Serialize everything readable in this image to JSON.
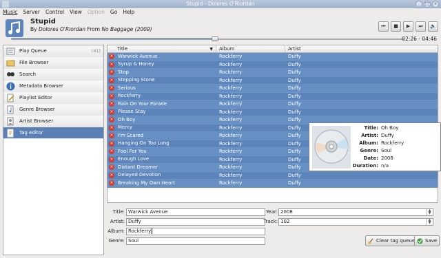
{
  "window": {
    "title": "Stupid - Dolores O'Riordan",
    "buttons": [
      "close-icon",
      "maximize-icon",
      "minimize-icon"
    ]
  },
  "menu": [
    "Music",
    "Server",
    "Control",
    "View",
    "Option",
    "Go",
    "Help"
  ],
  "now_playing": {
    "title": "Stupid",
    "by_prefix": "By",
    "artist": "Dolores O'Riordan",
    "from_prefix": "From",
    "album": "No Baggage",
    "year": "(2009)",
    "time": "02:26 - 04:46",
    "progress": 0.52,
    "controls": [
      "previous-icon",
      "stop-icon",
      "play-icon",
      "next-icon",
      "volume-icon"
    ]
  },
  "sidebar": {
    "items": [
      {
        "label": "Play Queue",
        "count": "(41)",
        "icon": "queue-icon"
      },
      {
        "label": "File Browser",
        "icon": "file-browser-icon"
      },
      {
        "label": "Search",
        "icon": "search-icon"
      },
      {
        "label": "Metadata Browser",
        "icon": "info-icon"
      },
      {
        "label": "Playlist Editor",
        "icon": "playlist-editor-icon"
      },
      {
        "label": "Genre Browser",
        "icon": "genre-icon"
      },
      {
        "label": "Artist Browser",
        "icon": "artist-icon"
      },
      {
        "label": "Tag editor",
        "icon": "tag-icon",
        "active": true
      }
    ]
  },
  "playlist": {
    "columns": [
      "Title",
      "Album",
      "Artist"
    ],
    "rows": [
      {
        "title": "Warwick Avenue",
        "album": "Rockferry",
        "artist": "Duffy"
      },
      {
        "title": "Syrup & Honey",
        "album": "Rockferry",
        "artist": "Duffy"
      },
      {
        "title": "Stop",
        "album": "Rockferry",
        "artist": "Duffy"
      },
      {
        "title": "Stepping Stone",
        "album": "Rockferry",
        "artist": "Duffy"
      },
      {
        "title": "Serious",
        "album": "Rockferry",
        "artist": "Duffy"
      },
      {
        "title": "Rockferry",
        "album": "Rockferry",
        "artist": "Duffy"
      },
      {
        "title": "Rain On Your Parade",
        "album": "Rockferry",
        "artist": "Duffy"
      },
      {
        "title": "Please Stay",
        "album": "Rockferry",
        "artist": "Duffy"
      },
      {
        "title": "Oh Boy",
        "album": "Rockferry",
        "artist": "Duffy"
      },
      {
        "title": "Mercy",
        "album": "Rockferry",
        "artist": "Duffy"
      },
      {
        "title": "I'm Scared",
        "album": "Rockferry",
        "artist": "Duffy"
      },
      {
        "title": "Hanging On Too Long",
        "album": "Rockferry",
        "artist": "Duffy"
      },
      {
        "title": "Fool For You",
        "album": "Rockferry",
        "artist": "Duffy"
      },
      {
        "title": "Enough Love",
        "album": "Rockferry",
        "artist": "Duffy"
      },
      {
        "title": "Distant Dreamer",
        "album": "Rockferry",
        "artist": "Duffy"
      },
      {
        "title": "Delayed Devotion",
        "album": "Rockferry",
        "artist": "Duffy"
      },
      {
        "title": "Breaking My Own Heart",
        "album": "Rockferry",
        "artist": "Duffy"
      }
    ]
  },
  "tooltip": {
    "fields": [
      {
        "label": "Title:",
        "value": "Oh Boy"
      },
      {
        "label": "Artist:",
        "value": "Duffy"
      },
      {
        "label": "Album:",
        "value": "Rockferry"
      },
      {
        "label": "Genre:",
        "value": "Soul"
      },
      {
        "label": "Date:",
        "value": "2008"
      },
      {
        "label": "Duration:",
        "value": "n/a"
      }
    ]
  },
  "editor": {
    "title_label": "Title:",
    "title_value": "Warwick Avenue",
    "artist_label": "Artist:",
    "artist_value": "Duffy",
    "album_label": "Album:",
    "album_value": "Rockferry",
    "genre_label": "Genre:",
    "genre_value": "Soul",
    "year_label": "Year:",
    "year_value": "2008",
    "track_label": "Track:",
    "track_value": "102",
    "clear_button": "Clear tag queue",
    "save_button": "Save"
  },
  "colors": {
    "selection": "#5b84ba",
    "remove": "#d43a2e"
  }
}
